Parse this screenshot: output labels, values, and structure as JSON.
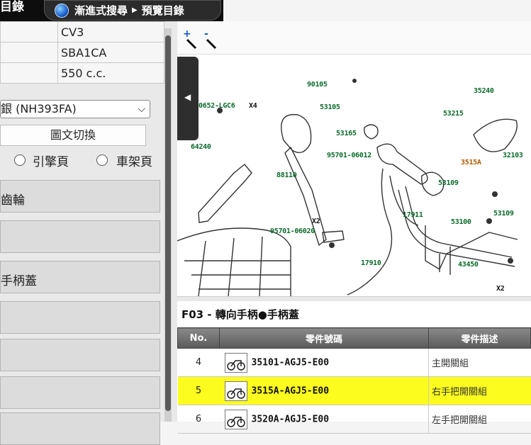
{
  "title": "目錄",
  "breadcrumb": {
    "item1": "漸進式搜尋",
    "item2": "預覽目錄",
    "icon": "globe-icon"
  },
  "info": [
    {
      "label": "",
      "value": "CV3"
    },
    {
      "label": "",
      "value": "SBA1CA"
    },
    {
      "label": "",
      "value": "550 c.c."
    }
  ],
  "color_select": {
    "value": "銀 (NH393FA)",
    "icon": "chevron-down-icon"
  },
  "switch_button": "圖文切換",
  "view_options": [
    {
      "label": "引擎頁",
      "selected": false
    },
    {
      "label": "車架頁",
      "selected": false
    }
  ],
  "categories": [
    "齒輪",
    "",
    "手柄蓋",
    "",
    "",
    "",
    ""
  ],
  "zoom": {
    "in_icon": "zoom-in-icon",
    "out_icon": "zoom-out-icon"
  },
  "diagram_labels": {
    "l90105": "90105",
    "l35240": "35240",
    "l90652": "0652-LGC6",
    "lx4": "X4",
    "l53105": "53105",
    "l53215": "53215",
    "l53165": "53165",
    "l64240": "64240",
    "l95701a": "95701-06012",
    "l3515a": "3515A",
    "l32103": "32103",
    "l88110": "88110",
    "l53109a": "53109",
    "l17911": "17911",
    "l53109b": "53109",
    "lx2a": "X2",
    "l53100": "53100",
    "l95701b": "95701-06020",
    "l17910": "17910",
    "l43450": "43450",
    "lx2b": "X2"
  },
  "section_title": "F03 - 轉向手柄●手柄蓋",
  "parts_table": {
    "headers": {
      "no": "No.",
      "code": "零件號碼",
      "desc": "零件描述"
    },
    "rows": [
      {
        "no": "4",
        "code": "35101-AGJ5-E00",
        "desc": "主開關組",
        "highlight": false
      },
      {
        "no": "5",
        "code": "3515A-AGJ5-E00",
        "desc": "右手把開關組",
        "highlight": true
      },
      {
        "no": "6",
        "code": "3520A-AGJ5-E00",
        "desc": "左手把開關組",
        "highlight": false
      }
    ]
  },
  "colors": {
    "highlight": "#fcfc1e",
    "part_number_green": "#0a6b2a",
    "topbar": "#0d0d0d"
  }
}
